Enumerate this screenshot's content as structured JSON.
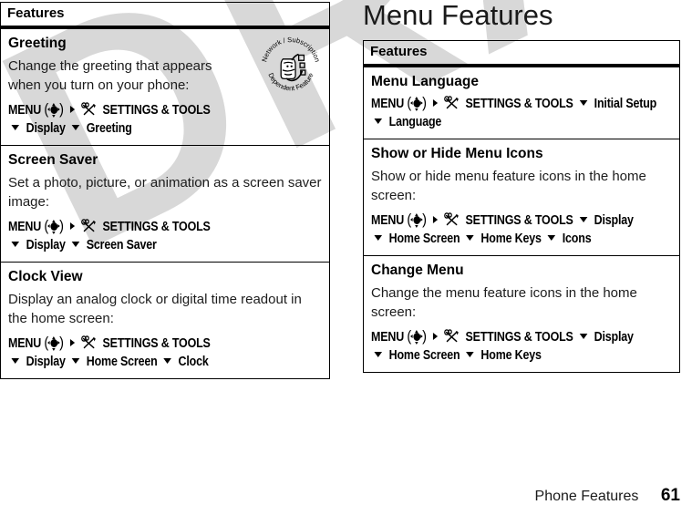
{
  "document": {
    "page_heading": "Menu Features",
    "watermark": "DRAFT",
    "footer": {
      "label": "Phone Features",
      "page_number": "61"
    }
  },
  "glyphs": {
    "menu_word": "MENU",
    "navkey_icon": "navigation-key-icon",
    "arrow_right_icon": "arrow-right-icon",
    "arrow_down_icon": "arrow-down-icon",
    "tools_icon": "settings-and-tools-icon",
    "settings_tools_label": "SETTINGS & TOOLS",
    "paren_left": "(",
    "paren_right": ")"
  },
  "badge": {
    "name": "network-subscription-dependent-feature-badge",
    "top_text": "Network / Subscription",
    "bottom_text": "Dependent Feature"
  },
  "left_table": {
    "header": "Features",
    "rows": [
      {
        "title": "Greeting",
        "body": "Change the greeting that appears when you turn on your phone:",
        "path_line1": "SETTINGS & TOOLS",
        "path_line2": [
          "Display",
          "Greeting"
        ],
        "has_badge": true
      },
      {
        "title": "Screen Saver",
        "body": "Set a photo, picture, or animation as a screen saver image:",
        "path_line1": "SETTINGS & TOOLS",
        "path_line2": [
          "Display",
          "Screen Saver"
        ],
        "has_badge": false
      },
      {
        "title": "Clock View",
        "body": "Display an analog clock or digital time readout in the home screen:",
        "path_line1": "SETTINGS & TOOLS",
        "path_line2": [
          "Display",
          "Home Screen",
          "Clock"
        ],
        "has_badge": false
      }
    ]
  },
  "right_table": {
    "header": "Features",
    "rows": [
      {
        "title": "Menu Language",
        "body": "",
        "path_line1": "SETTINGS & TOOLS",
        "path_line1_tail": [
          "Initial Setup"
        ],
        "path_line2": [
          "Language"
        ],
        "has_badge": false
      },
      {
        "title": "Show or Hide Menu Icons",
        "body": "Show or hide menu feature icons in the home screen:",
        "path_line1": "SETTINGS & TOOLS",
        "path_line1_tail": [
          "Display"
        ],
        "path_line2": [
          "Home Screen",
          "Home Keys",
          "Icons"
        ],
        "has_badge": false
      },
      {
        "title": "Change Menu",
        "body": "Change the menu feature icons in the home screen:",
        "path_line1": "SETTINGS & TOOLS",
        "path_line1_tail": [
          "Display"
        ],
        "path_line2": [
          "Home Screen",
          "Home Keys"
        ],
        "has_badge": false
      }
    ]
  },
  "colors": {
    "ink": "#000000",
    "body_ink": "#1c1c1c",
    "watermark": "#d8d8d8",
    "paper": "#ffffff"
  }
}
